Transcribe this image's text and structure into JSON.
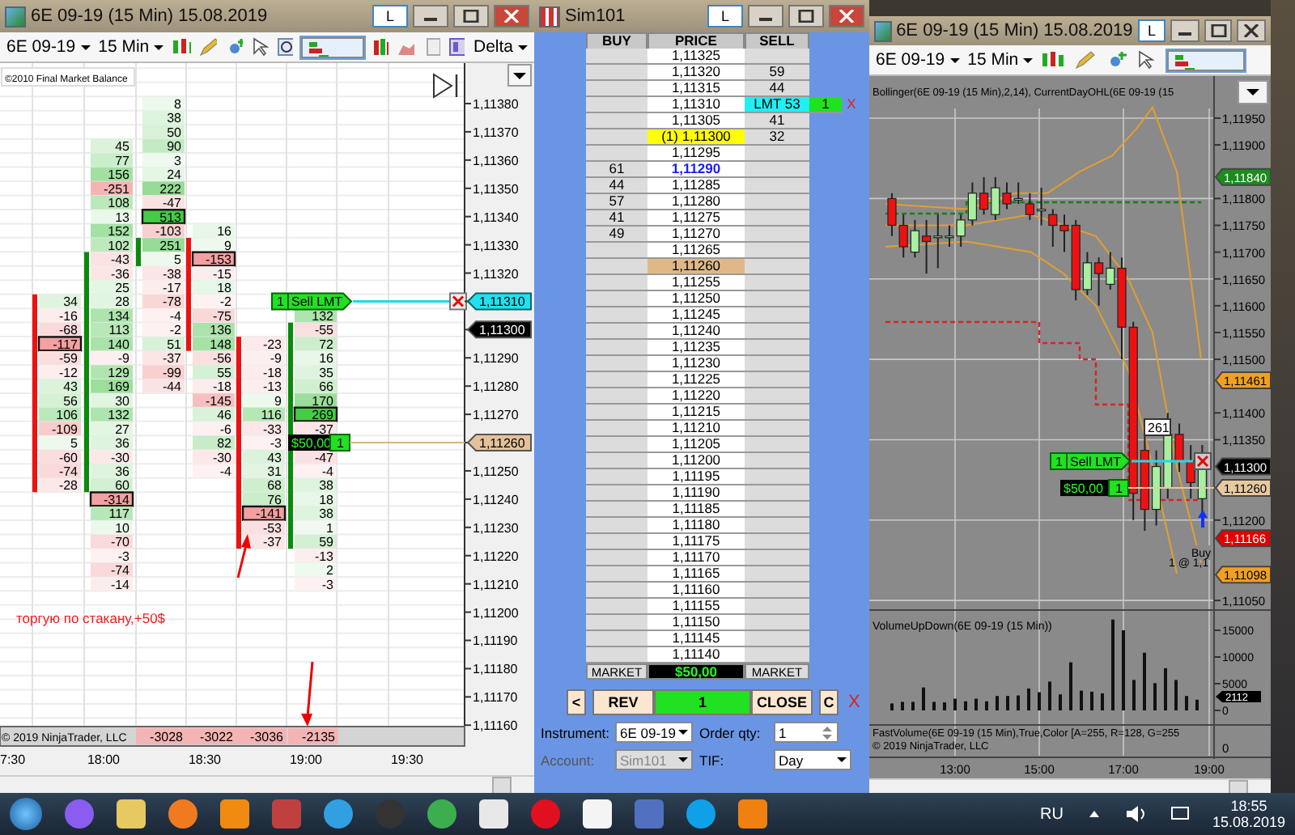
{
  "left_window": {
    "title": "6E 09-19 (15 Min)  15.08.2019",
    "title_button": "L",
    "toolbar": {
      "instrument": "6E 09-19",
      "interval": "15 Min",
      "study": "Delta"
    },
    "chart": {
      "caption": "©2010 Final Market Balance",
      "columns": [
        {
          "rising": false
        },
        {
          "rising": true
        },
        {
          "rising": true
        },
        {
          "rising": false
        },
        {
          "rising": false
        },
        {
          "rising": true
        }
      ],
      "rows": [
        [
          null,
          null,
          {
            "v": "8",
            "boxed": false
          },
          null,
          null,
          null
        ],
        [
          null,
          null,
          {
            "v": "38",
            "boxed": false
          },
          null,
          null,
          null
        ],
        [
          null,
          null,
          {
            "v": "50",
            "boxed": false
          },
          null,
          null,
          null
        ],
        [
          null,
          {
            "v": "45",
            "boxed": false
          },
          {
            "v": "90",
            "boxed": false
          },
          null,
          null,
          null
        ],
        [
          null,
          {
            "v": "77",
            "boxed": false
          },
          {
            "v": "3",
            "boxed": false
          },
          null,
          null,
          null
        ],
        [
          null,
          {
            "v": "156",
            "boxed": false
          },
          {
            "v": "24",
            "boxed": false
          },
          null,
          null,
          null
        ],
        [
          null,
          {
            "v": "-251",
            "boxed": false
          },
          {
            "v": "222",
            "boxed": false
          },
          null,
          null,
          null
        ],
        [
          null,
          {
            "v": "108",
            "boxed": false
          },
          {
            "v": "-47",
            "boxed": false
          },
          null,
          null,
          null
        ],
        [
          null,
          {
            "v": "13",
            "boxed": false
          },
          {
            "v": "513",
            "boxed": true
          },
          null,
          null,
          null
        ],
        [
          null,
          {
            "v": "152",
            "boxed": false
          },
          {
            "v": "-103",
            "boxed": false
          },
          {
            "v": "16",
            "boxed": false
          },
          null,
          null
        ],
        [
          null,
          {
            "v": "102",
            "boxed": false
          },
          {
            "v": "251",
            "boxed": false
          },
          {
            "v": "9",
            "boxed": false
          },
          null,
          null
        ],
        [
          null,
          {
            "v": "-43",
            "boxed": false
          },
          {
            "v": "5",
            "boxed": false
          },
          {
            "v": "-153",
            "boxed": true
          },
          null,
          null
        ],
        [
          null,
          {
            "v": "-36",
            "boxed": false
          },
          {
            "v": "-38",
            "boxed": false
          },
          {
            "v": "-15",
            "boxed": false
          },
          null,
          null
        ],
        [
          null,
          {
            "v": "25",
            "boxed": false
          },
          {
            "v": "-17",
            "boxed": false
          },
          {
            "v": "18",
            "boxed": false
          },
          null,
          null
        ],
        [
          {
            "v": "34",
            "boxed": false
          },
          {
            "v": "28",
            "boxed": false
          },
          {
            "v": "-78",
            "boxed": false
          },
          {
            "v": "-2",
            "boxed": false
          },
          null,
          null
        ],
        [
          {
            "v": "-16",
            "boxed": false
          },
          {
            "v": "134",
            "boxed": false
          },
          {
            "v": "-4",
            "boxed": false
          },
          {
            "v": "-75",
            "boxed": false
          },
          null,
          {
            "v": "132",
            "boxed": false
          }
        ],
        [
          {
            "v": "-68",
            "boxed": false
          },
          {
            "v": "113",
            "boxed": false
          },
          {
            "v": "-2",
            "boxed": false
          },
          {
            "v": "136",
            "boxed": false
          },
          null,
          {
            "v": "-55",
            "boxed": false
          }
        ],
        [
          {
            "v": "-117",
            "boxed": true
          },
          {
            "v": "140",
            "boxed": false
          },
          {
            "v": "51",
            "boxed": false
          },
          {
            "v": "148",
            "boxed": false
          },
          {
            "v": "-23",
            "boxed": false
          },
          {
            "v": "72",
            "boxed": false
          }
        ],
        [
          {
            "v": "-59",
            "boxed": false
          },
          {
            "v": "-9",
            "boxed": false
          },
          {
            "v": "-37",
            "boxed": false
          },
          {
            "v": "-56",
            "boxed": false
          },
          {
            "v": "-9",
            "boxed": false
          },
          {
            "v": "16",
            "boxed": false
          }
        ],
        [
          {
            "v": "-12",
            "boxed": false
          },
          {
            "v": "129",
            "boxed": false
          },
          {
            "v": "-99",
            "boxed": false
          },
          {
            "v": "55",
            "boxed": false
          },
          {
            "v": "-18",
            "boxed": false
          },
          {
            "v": "35",
            "boxed": false
          }
        ],
        [
          {
            "v": "43",
            "boxed": false
          },
          {
            "v": "169",
            "boxed": false
          },
          {
            "v": "-44",
            "boxed": false
          },
          {
            "v": "-18",
            "boxed": false
          },
          {
            "v": "-13",
            "boxed": false
          },
          {
            "v": "66",
            "boxed": false
          }
        ],
        [
          {
            "v": "56",
            "boxed": false
          },
          {
            "v": "30",
            "boxed": false
          },
          null,
          {
            "v": "-145",
            "boxed": false
          },
          {
            "v": "9",
            "boxed": false
          },
          {
            "v": "170",
            "boxed": false
          }
        ],
        [
          {
            "v": "106",
            "boxed": false
          },
          {
            "v": "132",
            "boxed": false
          },
          null,
          {
            "v": "46",
            "boxed": false
          },
          {
            "v": "116",
            "boxed": false
          },
          {
            "v": "269",
            "boxed": true
          }
        ],
        [
          {
            "v": "-109",
            "boxed": false
          },
          {
            "v": "27",
            "boxed": false
          },
          null,
          {
            "v": "-6",
            "boxed": false
          },
          {
            "v": "-33",
            "boxed": false
          },
          {
            "v": "-37",
            "boxed": false
          }
        ],
        [
          {
            "v": "5",
            "boxed": false
          },
          {
            "v": "36",
            "boxed": false
          },
          null,
          {
            "v": "82",
            "boxed": false
          },
          {
            "v": "-3",
            "boxed": false
          },
          null
        ],
        [
          {
            "v": "-60",
            "boxed": false
          },
          {
            "v": "-30",
            "boxed": false
          },
          null,
          {
            "v": "-30",
            "boxed": false
          },
          {
            "v": "43",
            "boxed": false
          },
          {
            "v": "-47",
            "boxed": false
          }
        ],
        [
          {
            "v": "-74",
            "boxed": false
          },
          {
            "v": "36",
            "boxed": false
          },
          null,
          {
            "v": "-4",
            "boxed": false
          },
          {
            "v": "31",
            "boxed": false
          },
          {
            "v": "-4",
            "boxed": false
          }
        ],
        [
          {
            "v": "-28",
            "boxed": false
          },
          {
            "v": "60",
            "boxed": false
          },
          null,
          null,
          {
            "v": "68",
            "boxed": false
          },
          {
            "v": "38",
            "boxed": false
          }
        ],
        [
          null,
          {
            "v": "-314",
            "boxed": true
          },
          null,
          null,
          {
            "v": "76",
            "boxed": false
          },
          {
            "v": "18",
            "boxed": false
          }
        ],
        [
          null,
          {
            "v": "117",
            "boxed": false
          },
          null,
          null,
          {
            "v": "-141",
            "boxed": true
          },
          {
            "v": "38",
            "boxed": false
          }
        ],
        [
          null,
          {
            "v": "10",
            "boxed": false
          },
          null,
          null,
          {
            "v": "-53",
            "boxed": false
          },
          {
            "v": "1",
            "boxed": false
          }
        ],
        [
          null,
          {
            "v": "-70",
            "boxed": false
          },
          null,
          null,
          {
            "v": "-37",
            "boxed": false
          },
          {
            "v": "59",
            "boxed": false
          }
        ],
        [
          null,
          {
            "v": "-3",
            "boxed": false
          },
          null,
          null,
          null,
          {
            "v": "-13",
            "boxed": false
          }
        ],
        [
          null,
          {
            "v": "-74",
            "boxed": false
          },
          null,
          null,
          null,
          {
            "v": "2",
            "boxed": false
          }
        ],
        [
          null,
          {
            "v": "-14",
            "boxed": false
          },
          null,
          null,
          null,
          {
            "v": "-3",
            "boxed": false
          }
        ]
      ],
      "totals": [
        "-3028",
        "-3022",
        "-3036",
        "-2135"
      ],
      "copyright": "© 2019 NinjaTrader, LLC",
      "price_ticks": [
        {
          "text": "1,11380",
          "kind": "plain"
        },
        {
          "text": "1,11370",
          "kind": "plain"
        },
        {
          "text": "1,11360",
          "kind": "plain"
        },
        {
          "text": "1,11350",
          "kind": "plain"
        },
        {
          "text": "1,11340",
          "kind": "plain"
        },
        {
          "text": "1,11330",
          "kind": "plain"
        },
        {
          "text": "1,11320",
          "kind": "plain"
        },
        {
          "text": "1,11310",
          "kind": "order"
        },
        {
          "text": "1,11300",
          "kind": "last"
        },
        {
          "text": "1,11290",
          "kind": "plain"
        },
        {
          "text": "1,11280",
          "kind": "plain"
        },
        {
          "text": "1,11270",
          "kind": "plain"
        },
        {
          "text": "1,11260",
          "kind": "position"
        },
        {
          "text": "1,11250",
          "kind": "plain"
        },
        {
          "text": "1,11240",
          "kind": "plain"
        },
        {
          "text": "1,11230",
          "kind": "plain"
        },
        {
          "text": "1,11220",
          "kind": "plain"
        },
        {
          "text": "1,11210",
          "kind": "plain"
        },
        {
          "text": "1,11200",
          "kind": "plain"
        },
        {
          "text": "1,11190",
          "kind": "plain"
        },
        {
          "text": "1,11180",
          "kind": "plain"
        },
        {
          "text": "1,11170",
          "kind": "plain"
        },
        {
          "text": "1,11160",
          "kind": "plain"
        }
      ],
      "sell_order": {
        "qty": "1",
        "label": "Sell LMT"
      },
      "position": {
        "pnl": "$50,00",
        "qty": "1"
      },
      "time_ticks": [
        "7:30",
        "18:00",
        "18:30",
        "19:00",
        "19:30"
      ],
      "note": "торгую по стакану,+50$"
    }
  },
  "ladder_window": {
    "title": "Sim101",
    "title_button": "L",
    "headers": [
      "BUY",
      "PRICE",
      "SELL"
    ],
    "rows": [
      {
        "price": "1,11325",
        "kind": "plain"
      },
      {
        "price": "1,11320",
        "sell": "59",
        "kind": "plain"
      },
      {
        "price": "1,11315",
        "sell": "44",
        "kind": "plain"
      },
      {
        "price": "1,11310",
        "sell": "LMT 53",
        "kind": "order",
        "order": {
          "qty": "1",
          "cancel": "X"
        }
      },
      {
        "price": "1,11305",
        "sell": "41",
        "kind": "plain"
      },
      {
        "price": "(1) 1,11300",
        "sell": "32",
        "kind": "position"
      },
      {
        "price": "1,11295",
        "kind": "plain"
      },
      {
        "price": "1,11290",
        "buy": "61",
        "kind": "last"
      },
      {
        "price": "1,11285",
        "buy": "44",
        "kind": "plain"
      },
      {
        "price": "1,11280",
        "buy": "57",
        "kind": "plain"
      },
      {
        "price": "1,11275",
        "buy": "41",
        "kind": "plain"
      },
      {
        "price": "1,11270",
        "buy": "49",
        "kind": "plain"
      },
      {
        "price": "1,11265",
        "kind": "plain"
      },
      {
        "price": "1,11260",
        "kind": "average"
      },
      {
        "price": "1,11255",
        "kind": "plain"
      },
      {
        "price": "1,11250",
        "kind": "plain"
      },
      {
        "price": "1,11245",
        "kind": "plain"
      },
      {
        "price": "1,11240",
        "kind": "plain"
      },
      {
        "price": "1,11235",
        "kind": "plain"
      },
      {
        "price": "1,11230",
        "kind": "plain"
      },
      {
        "price": "1,11225",
        "kind": "plain"
      },
      {
        "price": "1,11220",
        "kind": "plain"
      },
      {
        "price": "1,11215",
        "kind": "plain"
      },
      {
        "price": "1,11210",
        "kind": "plain"
      },
      {
        "price": "1,11205",
        "kind": "plain"
      },
      {
        "price": "1,11200",
        "kind": "plain"
      },
      {
        "price": "1,11195",
        "kind": "plain"
      },
      {
        "price": "1,11190",
        "kind": "plain"
      },
      {
        "price": "1,11185",
        "kind": "plain"
      },
      {
        "price": "1,11180",
        "kind": "plain"
      },
      {
        "price": "1,11175",
        "kind": "plain"
      },
      {
        "price": "1,11170",
        "kind": "plain"
      },
      {
        "price": "1,11165",
        "kind": "plain"
      },
      {
        "price": "1,11160",
        "kind": "plain"
      },
      {
        "price": "1,11155",
        "kind": "plain"
      },
      {
        "price": "1,11150",
        "kind": "plain"
      },
      {
        "price": "1,11145",
        "kind": "plain"
      },
      {
        "price": "1,11140",
        "kind": "plain"
      }
    ],
    "footer": {
      "left": "MARKET",
      "pnl": "$50,00",
      "right": "MARKET"
    },
    "buttons": [
      {
        "label": "<",
        "kind": "small"
      },
      {
        "label": "REV",
        "kind": "action"
      },
      {
        "label": "1",
        "kind": "position"
      },
      {
        "label": "CLOSE",
        "kind": "action"
      },
      {
        "label": "C",
        "kind": "small"
      }
    ],
    "cancel_all": "X",
    "form": {
      "instrument_label": "Instrument:",
      "instrument": "6E 09-19",
      "qty_label": "Order qty:",
      "qty": "1",
      "account_label": "Account:",
      "account": "Sim101",
      "account_disabled": true,
      "tif_label": "TIF:",
      "tif": "Day"
    }
  },
  "right_window": {
    "title": "6E 09-19 (15 Min)  15.08.2019",
    "title_button": "L",
    "toolbar": {
      "instrument": "6E 09-19",
      "interval": "15 Min"
    },
    "indicator_label": "Bollinger(6E 09-19 (15 Min),2,14), CurrentDayOHL(6E 09-19 (15",
    "price_ticks": [
      "1,11950",
      "1,11900",
      "1,11800",
      "1,11750",
      "1,11700",
      "1,11650",
      "1,11600",
      "1,11550",
      "1,11500",
      "1,11400",
      "1,11350",
      "1,11200",
      "1,11050"
    ],
    "price_tags": [
      {
        "text": "1,11840",
        "kind": "day_high"
      },
      {
        "text": "1,11461",
        "kind": "band"
      },
      {
        "text": "1,11300",
        "kind": "last"
      },
      {
        "text": "1,11260",
        "kind": "position"
      },
      {
        "text": "1,11166",
        "kind": "day_low"
      },
      {
        "text": "1,11098",
        "kind": "band"
      }
    ],
    "bar_count": "261",
    "sell_order": {
      "qty": "1",
      "label": "Sell LMT"
    },
    "position": {
      "pnl": "$50,00",
      "qty": "1"
    },
    "fill_label": "Buy",
    "fill_detail": "1 @ 1,1",
    "volume": {
      "label": "VolumeUpDown(6E 09-19 (15 Min))",
      "tag": "2112",
      "ticks": [
        "15000",
        "10000",
        "5000",
        "0"
      ]
    },
    "fast_volume": {
      "label": "FastVolume(6E 09-19 (15 Min),True,Color [A=255, R=128, G=255",
      "copyright": "© 2019 NinjaTrader, LLC",
      "tick": "0"
    },
    "time_ticks": [
      "13:00",
      "15:00",
      "17:00",
      "19:00"
    ]
  },
  "taskbar": {
    "language": "RU",
    "time": "18:55",
    "date": "15.08.2019"
  }
}
